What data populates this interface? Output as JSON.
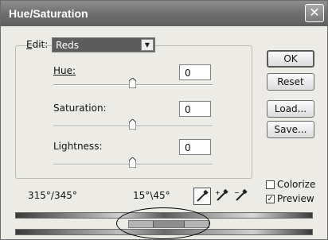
{
  "window": {
    "title": "Hue/Saturation",
    "close_glyph": "✕"
  },
  "edit": {
    "label_prefix": "E",
    "label_rest": "dit:",
    "selected": "Reds"
  },
  "hue": {
    "label": "Hue:",
    "value": "0",
    "level": 0.5
  },
  "saturation": {
    "label": "Saturation:",
    "value": "0",
    "level": 0.5
  },
  "lightness": {
    "label": "Lightness:",
    "value": "0",
    "level": 0.5
  },
  "buttons": {
    "ok": "OK",
    "reset": "Reset",
    "load": "Load...",
    "save": "Save..."
  },
  "options": {
    "colorize": "Colorize",
    "colorize_checked": false,
    "preview": "Preview",
    "preview_checked": true
  },
  "ranges": {
    "left": "315°/345°",
    "right": "15°\\45°"
  },
  "icons": [
    "eyedropper-icon",
    "eyedropper-plus-icon",
    "eyedropper-minus-icon"
  ]
}
